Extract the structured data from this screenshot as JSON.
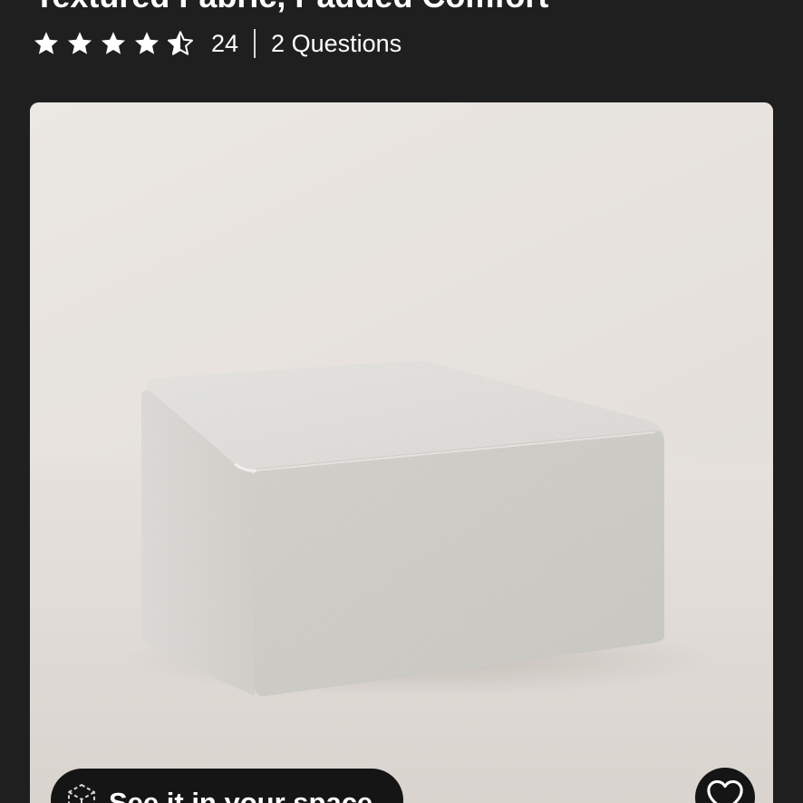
{
  "product": {
    "title": "Textured Fabric, Padded Comfort",
    "rating": 4.5,
    "max_rating": 5,
    "review_count": "24",
    "questions_label": "2 Questions"
  },
  "actions": {
    "ar_button_label": "See it in your space",
    "favorite_icon": "heart-outline-icon",
    "ar_icon": "ar-cube-icon"
  },
  "colors": {
    "background": "#1f1f1f",
    "text": "#ffffff",
    "image_backdrop": "#ebe6e2",
    "button_bg": "#151515"
  }
}
